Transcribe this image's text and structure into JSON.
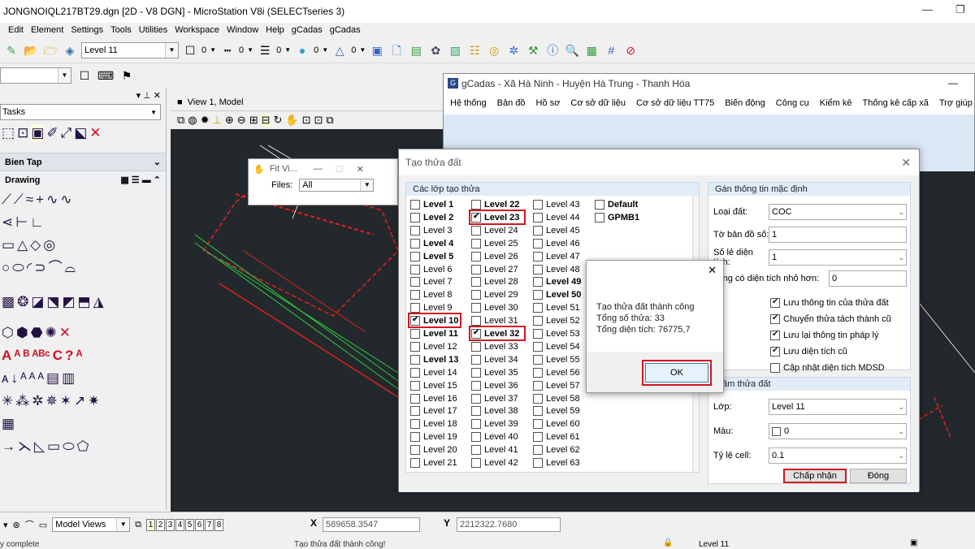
{
  "window": {
    "title": "JONGNOIQL217BT29.dgn [2D - V8 DGN] - MicroStation V8i (SELECTseries 3)"
  },
  "menu": [
    "Edit",
    "Element",
    "Settings",
    "Tools",
    "Utilities",
    "Workspace",
    "Window",
    "Help",
    "gCadas",
    "gCadas"
  ],
  "toolbar": {
    "level": "Level 11",
    "weight0": "0",
    "style0": "0",
    "ws0": "0",
    "c0": "0",
    "t0": "0"
  },
  "tasks": {
    "title": "Tasks",
    "section_bien_tap": "Bien Tap",
    "section_drawing": "Drawing"
  },
  "view": {
    "title": "View 1, Model"
  },
  "fitview": {
    "title": "Fit Vi...",
    "files_label": "Files:",
    "files_value": "All"
  },
  "gcadas": {
    "title": "gCadas - Xã Hà Ninh - Huyện Hà Trung - Thanh Hóa",
    "menu": [
      "Hệ thống",
      "Bản đồ",
      "Hồ sơ",
      "Cơ sở dữ liệu",
      "Cơ sở dữ liệu TT75",
      "Biến động",
      "Công cụ",
      "Kiểm kê",
      "Thống kê cấp xã",
      "Trợ giúp"
    ]
  },
  "dialog": {
    "title": "Tạo thửa đất",
    "layers_group": "Các lớp tạo thửa",
    "levels": [
      {
        "name": "Level 1",
        "checked": false,
        "bold": true
      },
      {
        "name": "Level 2",
        "checked": false,
        "bold": true
      },
      {
        "name": "Level 3",
        "checked": false,
        "bold": false
      },
      {
        "name": "Level 4",
        "checked": false,
        "bold": true
      },
      {
        "name": "Level 5",
        "checked": false,
        "bold": true
      },
      {
        "name": "Level 6",
        "checked": false,
        "bold": false
      },
      {
        "name": "Level 7",
        "checked": false,
        "bold": false
      },
      {
        "name": "Level 8",
        "checked": false,
        "bold": false
      },
      {
        "name": "Level 9",
        "checked": false,
        "bold": false
      },
      {
        "name": "Level 10",
        "checked": true,
        "bold": true
      },
      {
        "name": "Level 11",
        "checked": false,
        "bold": true
      },
      {
        "name": "Level 12",
        "checked": false,
        "bold": false
      },
      {
        "name": "Level 13",
        "checked": false,
        "bold": true
      },
      {
        "name": "Level 14",
        "checked": false,
        "bold": false
      },
      {
        "name": "Level 15",
        "checked": false,
        "bold": false
      },
      {
        "name": "Level 16",
        "checked": false,
        "bold": false
      },
      {
        "name": "Level 17",
        "checked": false,
        "bold": false
      },
      {
        "name": "Level 18",
        "checked": false,
        "bold": false
      },
      {
        "name": "Level 19",
        "checked": false,
        "bold": false
      },
      {
        "name": "Level 20",
        "checked": false,
        "bold": false
      },
      {
        "name": "Level 21",
        "checked": false,
        "bold": false
      },
      {
        "name": "Level 22",
        "checked": false,
        "bold": true
      },
      {
        "name": "Level 23",
        "checked": true,
        "bold": true
      },
      {
        "name": "Level 24",
        "checked": false,
        "bold": false
      },
      {
        "name": "Level 25",
        "checked": false,
        "bold": false
      },
      {
        "name": "Level 26",
        "checked": false,
        "bold": false
      },
      {
        "name": "Level 27",
        "checked": false,
        "bold": false
      },
      {
        "name": "Level 28",
        "checked": false,
        "bold": false
      },
      {
        "name": "Level 29",
        "checked": false,
        "bold": false
      },
      {
        "name": "Level 30",
        "checked": false,
        "bold": false
      },
      {
        "name": "Level 31",
        "checked": false,
        "bold": false
      },
      {
        "name": "Level 32",
        "checked": true,
        "bold": true
      },
      {
        "name": "Level 33",
        "checked": false,
        "bold": false
      },
      {
        "name": "Level 34",
        "checked": false,
        "bold": false
      },
      {
        "name": "Level 35",
        "checked": false,
        "bold": false
      },
      {
        "name": "Level 36",
        "checked": false,
        "bold": false
      },
      {
        "name": "Level 37",
        "checked": false,
        "bold": false
      },
      {
        "name": "Level 38",
        "checked": false,
        "bold": false
      },
      {
        "name": "Level 39",
        "checked": false,
        "bold": false
      },
      {
        "name": "Level 40",
        "checked": false,
        "bold": false
      },
      {
        "name": "Level 41",
        "checked": false,
        "bold": false
      },
      {
        "name": "Level 42",
        "checked": false,
        "bold": false
      },
      {
        "name": "Level 43",
        "checked": false,
        "bold": false
      },
      {
        "name": "Level 44",
        "checked": false,
        "bold": false
      },
      {
        "name": "Level 45",
        "checked": false,
        "bold": false
      },
      {
        "name": "Level 46",
        "checked": false,
        "bold": false
      },
      {
        "name": "Level 47",
        "checked": false,
        "bold": false
      },
      {
        "name": "Level 48",
        "checked": false,
        "bold": false
      },
      {
        "name": "Level 49",
        "checked": false,
        "bold": true
      },
      {
        "name": "Level 50",
        "checked": false,
        "bold": true
      },
      {
        "name": "Level 51",
        "checked": false,
        "bold": false
      },
      {
        "name": "Level 52",
        "checked": false,
        "bold": false
      },
      {
        "name": "Level 53",
        "checked": false,
        "bold": false
      },
      {
        "name": "Level 54",
        "checked": false,
        "bold": false
      },
      {
        "name": "Level 55",
        "checked": false,
        "bold": false
      },
      {
        "name": "Level 56",
        "checked": false,
        "bold": false
      },
      {
        "name": "Level 57",
        "checked": false,
        "bold": false
      },
      {
        "name": "Level 58",
        "checked": false,
        "bold": false
      },
      {
        "name": "Level 59",
        "checked": false,
        "bold": false
      },
      {
        "name": "Level 60",
        "checked": false,
        "bold": false
      },
      {
        "name": "Level 61",
        "checked": false,
        "bold": false
      },
      {
        "name": "Level 62",
        "checked": false,
        "bold": false
      },
      {
        "name": "Level 63",
        "checked": false,
        "bold": false
      },
      {
        "name": "Default",
        "checked": false,
        "bold": true
      },
      {
        "name": "GPMB1",
        "checked": false,
        "bold": true
      }
    ],
    "defaults_group": "Gán thông tin mặc định",
    "loai_dat_label": "Loại đất:",
    "loai_dat_value": "COC",
    "to_ban_do_label": "Tờ bản đồ số:",
    "to_ban_do_value": "1",
    "so_le_label": "Số lẻ diện tích:",
    "so_le_value": "1",
    "vung_label": "vùng có diện tích nhỏ hơn:",
    "vung_value": "0",
    "opt_luu_thong_tin": "Lưu thông tin của thửa đất",
    "opt_chuyen_thua": "Chuyển thửa tách thành cũ",
    "opt_luu_phap_ly": "Lưu lại thông tin pháp lý",
    "opt_luu_dien_tich": "Lưu diện tích cũ",
    "opt_cap_nhat": "Cập nhật diện tích MDSD",
    "center_group": "t tâm thửa đất",
    "lop_label": "Lớp:",
    "lop_value": "Level 11",
    "mau_label": "Màu:",
    "mau_value": "0",
    "tyle_label": "Tỷ lệ cell:",
    "tyle_value": "0.1",
    "accept": "Chấp nhận",
    "close": "Đóng"
  },
  "message": {
    "line1": "Tạo thửa đất thành công",
    "line2": "Tổng số thửa: 33",
    "line3": "Tổng diện tích: 76775,7",
    "ok": "OK"
  },
  "status": {
    "model_views": "Model Views",
    "x_value": "589658.3547",
    "y_value": "2212322.7680",
    "left": "y complete",
    "msg": "Tạo thửa đất thành công!",
    "level": "Level 11",
    "x_label": "X",
    "y_label": "Y"
  },
  "colors": {
    "accent_red": "#d4141e",
    "view_bg": "#23282d"
  }
}
